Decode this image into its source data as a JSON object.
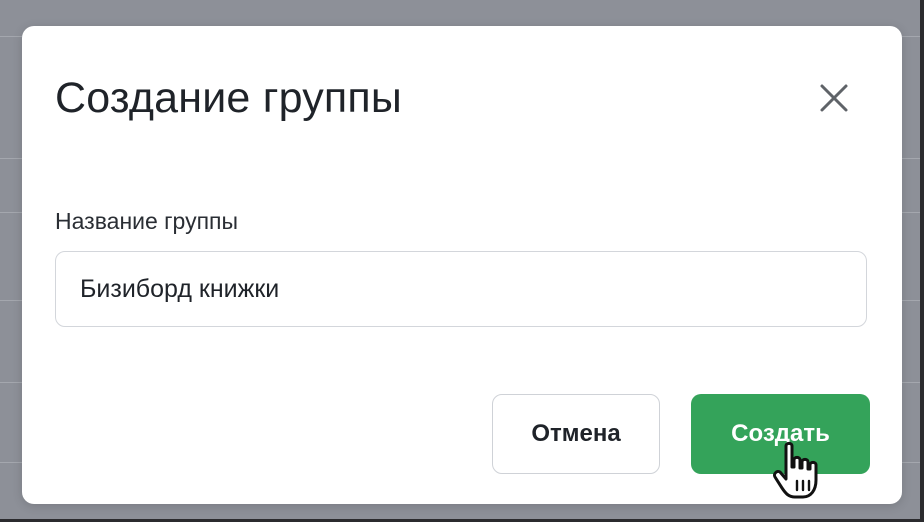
{
  "dialog": {
    "title": "Создание группы",
    "close_icon": "close-icon",
    "field_label": "Название группы",
    "input_value": "Бизиборд книжки",
    "cancel_label": "Отмена",
    "create_label": "Создать"
  },
  "cursor": {
    "icon": "hand-pointer-icon"
  },
  "colors": {
    "backdrop": "#8d9098",
    "primary": "#34a35a",
    "text": "#1f2329",
    "border": "#d3d6db"
  }
}
